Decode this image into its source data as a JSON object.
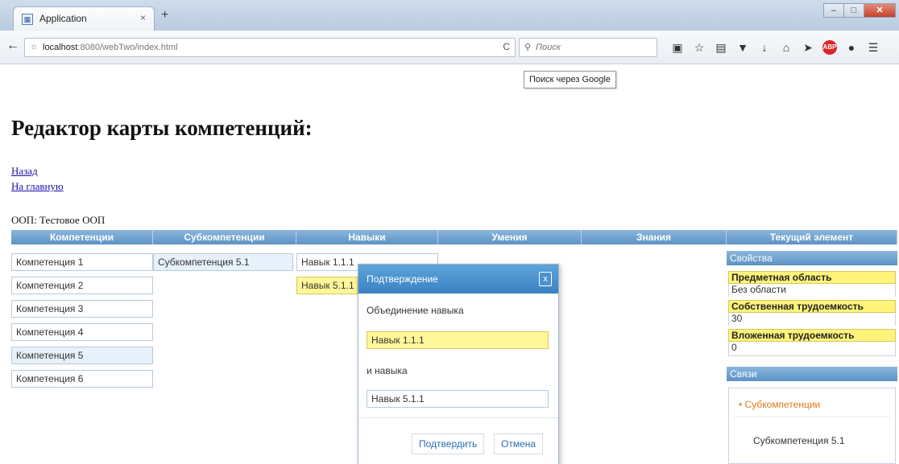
{
  "browser": {
    "tab_title": "Application",
    "tab_close": "×",
    "new_tab": "+",
    "url_host": "localhost",
    "url_rest": ":8080/webTwo/index.html",
    "refresh": "C",
    "search_placeholder": "Поиск",
    "tooltip": "Поиск через Google",
    "window_controls": [
      "–",
      "□",
      "✕"
    ]
  },
  "page": {
    "title": "Редактор карты компетенций:",
    "back_link": "Назад",
    "home_link": "На главную",
    "oop_label": "ООП: Тестовое ООП"
  },
  "columns": [
    "Компетенции",
    "Субкомпетенции",
    "Навыки",
    "Умения",
    "Знания",
    "Текущий элемент"
  ],
  "competencies": [
    "Компетенция 1",
    "Компетенция 2",
    "Компетенция 3",
    "Компетенция 4",
    "Компетенция 5",
    "Компетенция 6"
  ],
  "subcompetencies": [
    "Субкомпетенция 5.1"
  ],
  "skills": [
    "Навык 1.1.1",
    "Навык 5.1.1"
  ],
  "dialog": {
    "title": "Подтверждение",
    "close": "x",
    "text1": "Объединение навыка",
    "field1": "Навык 1.1.1",
    "text2": "и навыка",
    "field2": "Навык 5.1.1",
    "confirm": "Подтвердить",
    "cancel": "Отмена"
  },
  "right_panel": {
    "properties_header": "Свойства",
    "subject_label": "Предметная область",
    "subject_value": "Без области",
    "own_label": "Собственная трудоемкость",
    "own_value": "30",
    "nested_label": "Вложенная трудоемкость",
    "nested_value": "0",
    "links_header": "Связи",
    "links_group": "Субкомпетенции",
    "links_item": "Субкомпетенция 5.1"
  },
  "colors": {
    "header_blue": "#5d93c6",
    "highlight_yellow": "#fff799",
    "link_orange": "#e07a1a"
  }
}
